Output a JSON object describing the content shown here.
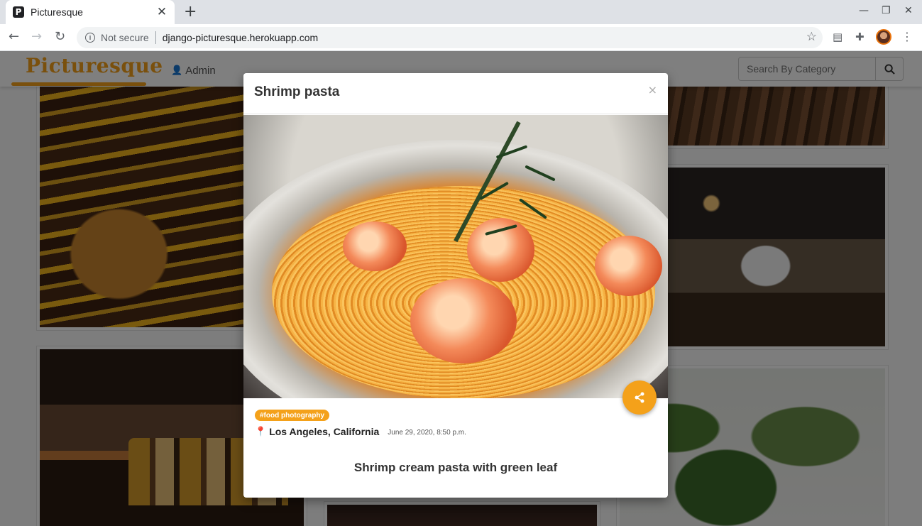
{
  "browser": {
    "tab_title": "Picturesque",
    "favicon_letter": "P",
    "not_secure_label": "Not secure",
    "url": "django-picturesque.herokuapp.com"
  },
  "site": {
    "logo": "Picturesque",
    "admin_label": "Admin",
    "search_placeholder": "Search By Category",
    "accent_color": "#f4a11a"
  },
  "modal": {
    "title": "Shrimp pasta",
    "close_label": "×",
    "tag": "#food photography",
    "location": "Los Angeles, California",
    "date": "June 29, 2020, 8:50 p.m.",
    "description": "Shrimp cream pasta with green leaf"
  },
  "gallery": {
    "cards": [
      "burger",
      "restaurant-interior",
      "bar-bottles",
      "dining-table",
      "plants",
      "dark-dining"
    ]
  }
}
